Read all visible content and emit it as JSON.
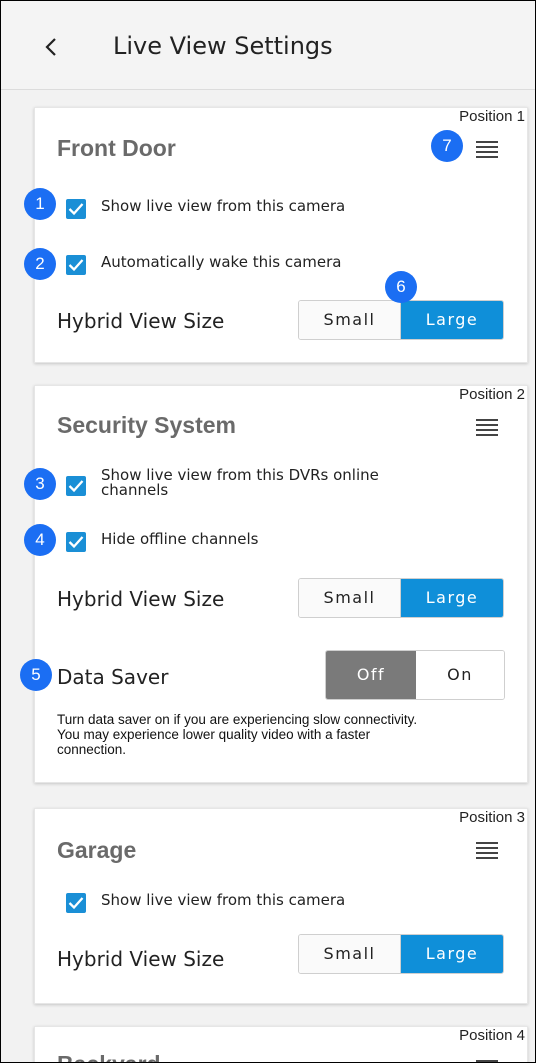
{
  "header": {
    "title": "Live View Settings"
  },
  "cards": [
    {
      "position_label": "Position 1",
      "name": "Front Door",
      "checkboxes": [
        {
          "label": "Show live view from this camera",
          "checked": true
        },
        {
          "label": "Automatically wake this camera",
          "checked": true
        }
      ],
      "hybrid": {
        "label": "Hybrid View Size",
        "options": [
          "Small",
          "Large"
        ],
        "selected": "Large"
      }
    },
    {
      "position_label": "Position 2",
      "name": "Security System",
      "checkboxes": [
        {
          "label_line1": "Show live view from this DVRs online",
          "label_line2": "channels",
          "checked": true
        },
        {
          "label": "Hide offline channels",
          "checked": true
        }
      ],
      "hybrid": {
        "label": "Hybrid View Size",
        "options": [
          "Small",
          "Large"
        ],
        "selected": "Large"
      },
      "data_saver": {
        "label": "Data Saver",
        "options": [
          "Off",
          "On"
        ],
        "selected": "Off",
        "help_line1": "Turn data saver on if you are experiencing slow connectivity.",
        "help_line2": "You may experience lower quality video with a faster",
        "help_line3": "connection."
      }
    },
    {
      "position_label": "Position 3",
      "name": "Garage",
      "checkboxes": [
        {
          "label": "Show live view from this camera",
          "checked": true
        }
      ],
      "hybrid": {
        "label": "Hybrid View Size",
        "options": [
          "Small",
          "Large"
        ],
        "selected": "Large"
      }
    },
    {
      "position_label": "Position 4",
      "name": "Backyard"
    }
  ],
  "annotations": [
    "1",
    "2",
    "3",
    "4",
    "5",
    "6",
    "7"
  ],
  "colors": {
    "accent": "#0f8fd9",
    "badge": "#1b6ef3",
    "off_selected": "#7a7a7a"
  }
}
